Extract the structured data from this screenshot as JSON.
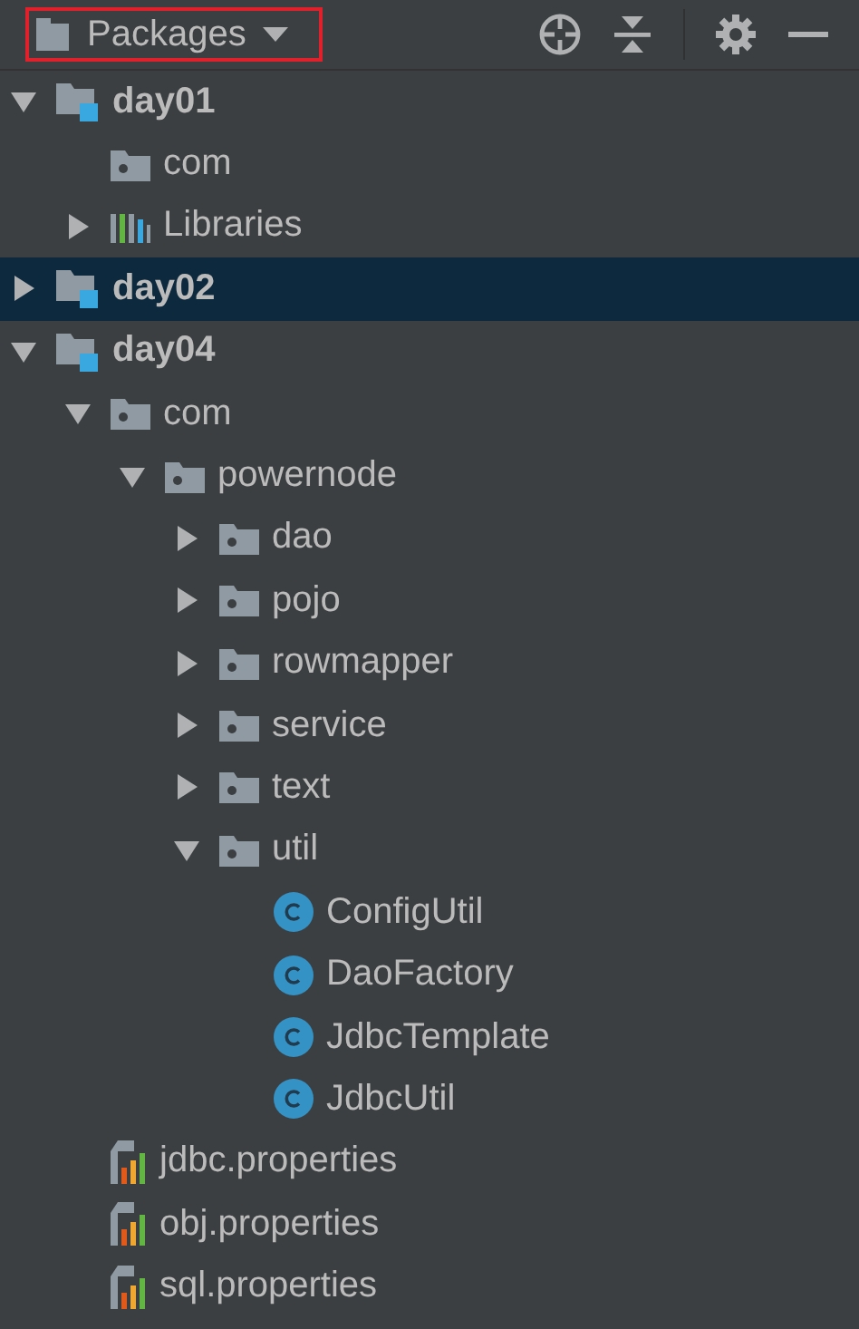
{
  "toolbar": {
    "view_selector": {
      "label": "Packages",
      "highlighted": true
    }
  },
  "tree": [
    {
      "label": "day01",
      "kind": "module",
      "expanded": true,
      "selected": false,
      "children": [
        {
          "label": "com",
          "kind": "package",
          "selected": false
        },
        {
          "label": "Libraries",
          "kind": "libraries",
          "expanded": false,
          "selected": false
        }
      ]
    },
    {
      "label": "day02",
      "kind": "module",
      "expanded": false,
      "selected": true
    },
    {
      "label": "day04",
      "kind": "module",
      "expanded": true,
      "selected": false,
      "children": [
        {
          "label": "com",
          "kind": "package",
          "expanded": true,
          "selected": false,
          "children": [
            {
              "label": "powernode",
              "kind": "package",
              "expanded": true,
              "selected": false,
              "children": [
                {
                  "label": "dao",
                  "kind": "package",
                  "expanded": false,
                  "selected": false
                },
                {
                  "label": "pojo",
                  "kind": "package",
                  "expanded": false,
                  "selected": false
                },
                {
                  "label": "rowmapper",
                  "kind": "package",
                  "expanded": false,
                  "selected": false
                },
                {
                  "label": "service",
                  "kind": "package",
                  "expanded": false,
                  "selected": false
                },
                {
                  "label": "text",
                  "kind": "package",
                  "expanded": false,
                  "selected": false
                },
                {
                  "label": "util",
                  "kind": "package",
                  "expanded": true,
                  "selected": false,
                  "children": [
                    {
                      "label": "ConfigUtil",
                      "kind": "class",
                      "selected": false
                    },
                    {
                      "label": "DaoFactory",
                      "kind": "class",
                      "selected": false
                    },
                    {
                      "label": "JdbcTemplate",
                      "kind": "class",
                      "selected": false
                    },
                    {
                      "label": "JdbcUtil",
                      "kind": "class",
                      "selected": false
                    }
                  ]
                }
              ]
            }
          ]
        },
        {
          "label": "jdbc.properties",
          "kind": "properties",
          "selected": false
        },
        {
          "label": "obj.properties",
          "kind": "properties",
          "selected": false
        },
        {
          "label": "sql.properties",
          "kind": "properties",
          "selected": false
        }
      ]
    }
  ]
}
